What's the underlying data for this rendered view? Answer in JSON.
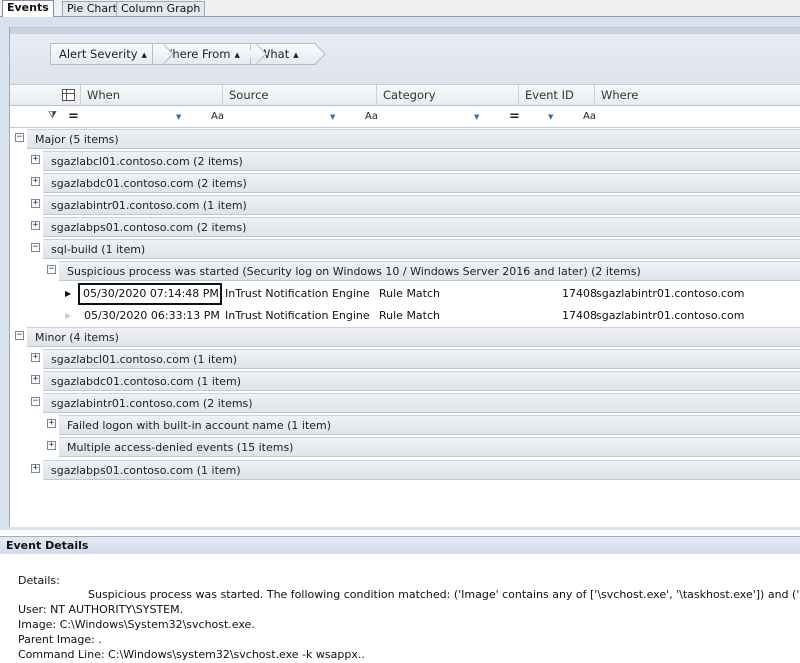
{
  "tabs": [
    {
      "label": "Events",
      "active": true
    },
    {
      "label": "Pie Chart",
      "active": false
    },
    {
      "label": "Column Graph",
      "active": false
    }
  ],
  "group_by": [
    {
      "label": "Alert Severity",
      "sort": "▲"
    },
    {
      "label": "Where From",
      "sort": "▲"
    },
    {
      "label": "What",
      "sort": "▲"
    }
  ],
  "columns": [
    "When",
    "Source",
    "Category",
    "Event ID",
    "Where"
  ],
  "filter_row": {
    "when_op": "=",
    "source_op": "Aa",
    "category_op": "Aa",
    "eventid_op": "=",
    "where_op": "Aa"
  },
  "groups": {
    "major": "Major (5 items)",
    "major_children": [
      "sgazlabcl01.contoso.com (2 items)",
      "sgazlabdc01.contoso.com (2 items)",
      "sgazlabintr01.contoso.com (1 item)",
      "sgazlabps01.contoso.com (2 items)",
      "sql-build (1 item)"
    ],
    "sql_build_child": "Suspicious process was started (Security log on Windows 10 / Windows Server 2016 and later) (2 items)",
    "minor": "Minor (4 items)",
    "minor_children": [
      "sgazlabcl01.contoso.com (1 item)",
      "sgazlabdc01.contoso.com (1 item)",
      "sgazlabintr01.contoso.com (2 items)",
      "sgazlabps01.contoso.com (1 item)"
    ],
    "intr01_children": [
      "Failed logon with built-in account name (1 item)",
      "Multiple access-denied events (15 items)"
    ]
  },
  "events": [
    {
      "when": "05/30/2020 07:14:48 PM",
      "source": "InTrust Notification Engine",
      "category": "Rule Match",
      "event_id": "17408",
      "where": "sgazlabintr01.contoso.com"
    },
    {
      "when": "05/30/2020 06:33:13 PM",
      "source": "InTrust Notification Engine",
      "category": "Rule Match",
      "event_id": "17408",
      "where": "sgazlabintr01.contoso.com"
    }
  ],
  "details": {
    "title": "Event Details",
    "label": "Details:",
    "description": "Suspicious process was started. The following condition matched: ('Image' contains any of ['\\svchost.exe', '\\taskhost.exe']) and ('Parent Image' does not c",
    "user": "User: NT AUTHORITY\\SYSTEM.",
    "image": "Image: C:\\Windows\\System32\\svchost.exe.",
    "parent_image": "Parent Image: .",
    "command_line": "Command Line: C:\\Windows\\system32\\svchost.exe -k wsappx.."
  },
  "icons": {
    "expand": "plus-box",
    "collapse": "minus-box",
    "current_row": "triangle-right",
    "filter": "funnel",
    "column_chooser": "column-chooser"
  }
}
